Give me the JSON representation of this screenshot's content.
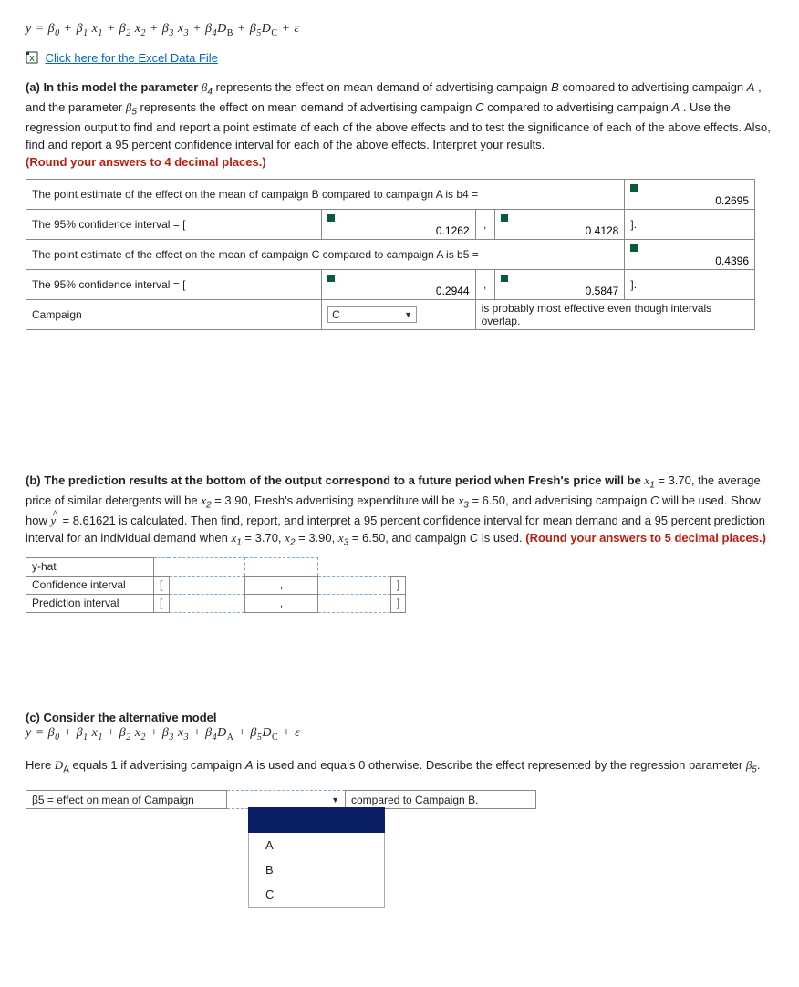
{
  "eq1": "y = β0 + β1 x1 + β2 x2 + β3 x3 + β4DB + β5DC + ε",
  "excel_link": " Click here for the Excel Data File",
  "a": {
    "lead": "(a) In this model the parameter ",
    "p1a": " represents the effect on mean demand of advertising campaign ",
    "B": "B",
    "p1b": " compared to advertising campaign ",
    "A": "A",
    "p1c": ", and the parameter ",
    "p1d": " represents the effect on mean demand of advertising campaign ",
    "C": "C",
    "p1e": " compared to advertising campaign ",
    "p1f": ". Use the regression output to find and report a point estimate of each of the above effects and to test the significance of each of the above effects. Also, find and report a 95 percent confidence interval for each of the above effects. Interpret your results. ",
    "round": "(Round your answers to 4 decimal places.)",
    "r1": "The point estimate of the effect on the mean of campaign B compared to campaign A is b4 =",
    "v1": "0.2695",
    "r2": "The 95% confidence interval = [",
    "v2a": "0.1262",
    "v2b": "0.4128",
    "rb": "].",
    "r3": "The point estimate of the effect on the mean of campaign C compared to campaign A is b5 =",
    "v3": "0.4396",
    "r4": "The 95% confidence interval = [",
    "v4a": "0.2944",
    "v4b": "0.5847",
    "r5": "Campaign",
    "ddval": "C",
    "r5b": "is probably most effective even though intervals overlap."
  },
  "b": {
    "lead": "(b) The prediction results at the bottom of the output correspond to a future period when Fresh's price will be ",
    "t1": " = 3.70, the average price of similar detergents will be ",
    "t2": " = 3.90, Fresh's advertising expenditure will be ",
    "t3": " = 6.50, and advertising campaign ",
    "t4": " will be used. Show how ",
    "t5": " = 8.61621 is calculated. Then find, report, and interpret a 95 percent confidence interval for mean demand and a 95 percent prediction interval for an individual demand when ",
    "t6": " = 3.70, ",
    "t7": " = 3.90, ",
    "t8": " = 6.50, and campaign ",
    "t9": " is used. ",
    "round": "(Round your answers to 5 decimal places.)",
    "row1": "y-hat",
    "row2": "Confidence interval",
    "row3": "Prediction interval",
    "lbr": "[",
    "rbr": "]",
    "comma": ","
  },
  "c": {
    "lead": "(c) Consider the alternative model",
    "eq": "y = β0 + β1 x1 + β2 x2 + β3 x3 + β4DA + β5DC + ε",
    "t1": "Here ",
    "t2": " equals 1 if advertising campaign ",
    "t3": " is used and equals 0 otherwise. Describe the effect represented by the regression parameter ",
    "t4": ".",
    "r1a": "β5 = effect on mean of Campaign",
    "r1c": "compared to Campaign B.",
    "opts": [
      "A",
      "B",
      "C"
    ]
  }
}
